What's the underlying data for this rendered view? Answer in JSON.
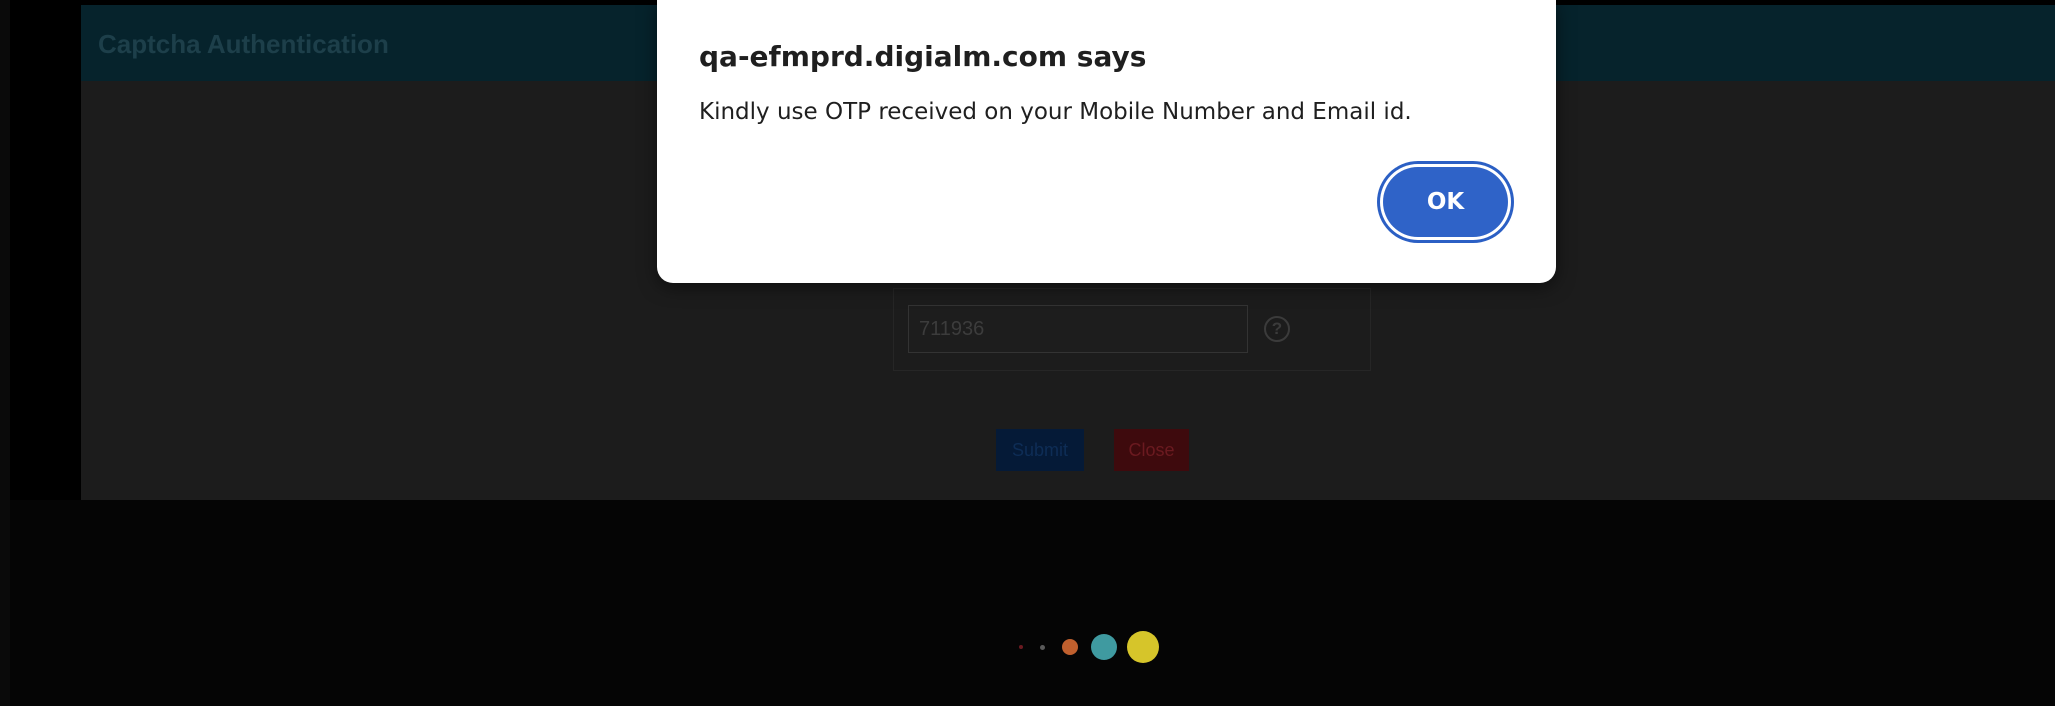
{
  "background_page": {
    "modal_title": "Captcha Authentication",
    "captcha_value": "711936",
    "help_symbol": "?",
    "submit_label": "Submit",
    "close_label": "Close"
  },
  "loader": {
    "dot_colors": [
      "#6b1a20",
      "#5a5a5a",
      "#c0602e",
      "#3f9aa0",
      "#d6c52a"
    ]
  },
  "alert_dialog": {
    "title": "qa-efmprd.digialm.com says",
    "message": "Kindly use OTP received on your Mobile Number and Email id.",
    "ok_label": "OK",
    "accent_color": "#2f63c8"
  }
}
